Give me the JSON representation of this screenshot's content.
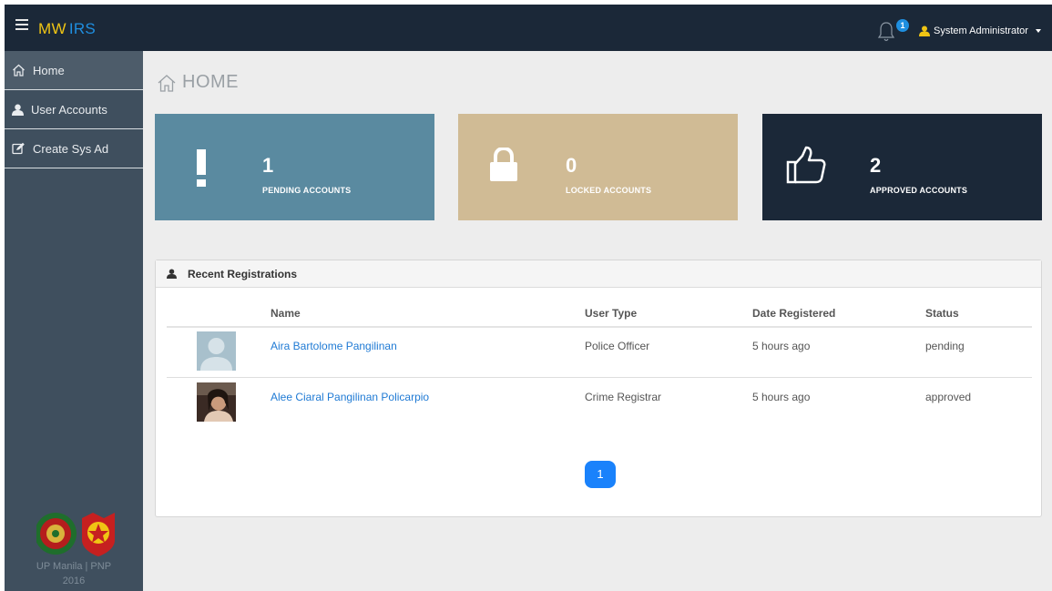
{
  "header": {
    "brand_primary": "MW",
    "brand_secondary": "IRS",
    "notification_count": "1",
    "user_name": "System Administrator"
  },
  "sidebar": {
    "items": [
      {
        "label": "Home",
        "icon": "home-icon",
        "active": true
      },
      {
        "label": "User Accounts",
        "icon": "user-icon",
        "active": false
      },
      {
        "label": "Create Sys Ad",
        "icon": "edit-icon",
        "active": false
      }
    ],
    "footer_line1": "UP Manila | PNP",
    "footer_line2": "2016"
  },
  "page": {
    "title": "HOME"
  },
  "stats": [
    {
      "value": "1",
      "label": "PENDING ACCOUNTS",
      "icon": "exclamation-icon",
      "color": "#5a8aa0"
    },
    {
      "value": "0",
      "label": "LOCKED ACCOUNTS",
      "icon": "lock-icon",
      "color": "#d0bb95"
    },
    {
      "value": "2",
      "label": "APPROVED ACCOUNTS",
      "icon": "thumbs-up-icon",
      "color": "#1b2838"
    }
  ],
  "registrations": {
    "title": "Recent Registrations",
    "columns": [
      "Name",
      "User Type",
      "Date Registered",
      "Status"
    ],
    "rows": [
      {
        "name": "Aira Bartolome Pangilinan",
        "user_type": "Police Officer",
        "date": "5 hours ago",
        "status": "pending"
      },
      {
        "name": "Alee Ciaral Pangilinan Policarpio",
        "user_type": "Crime Registrar",
        "date": "5 hours ago",
        "status": "approved"
      }
    ]
  },
  "pagination": {
    "current_page": "1"
  },
  "colors": {
    "topbar": "#1b2838",
    "brand_yellow": "#f0c514",
    "brand_blue": "#1f8fe0",
    "sidebar": "#3f4f5e",
    "link": "#1f7ad4",
    "pager": "#1a82fb"
  }
}
